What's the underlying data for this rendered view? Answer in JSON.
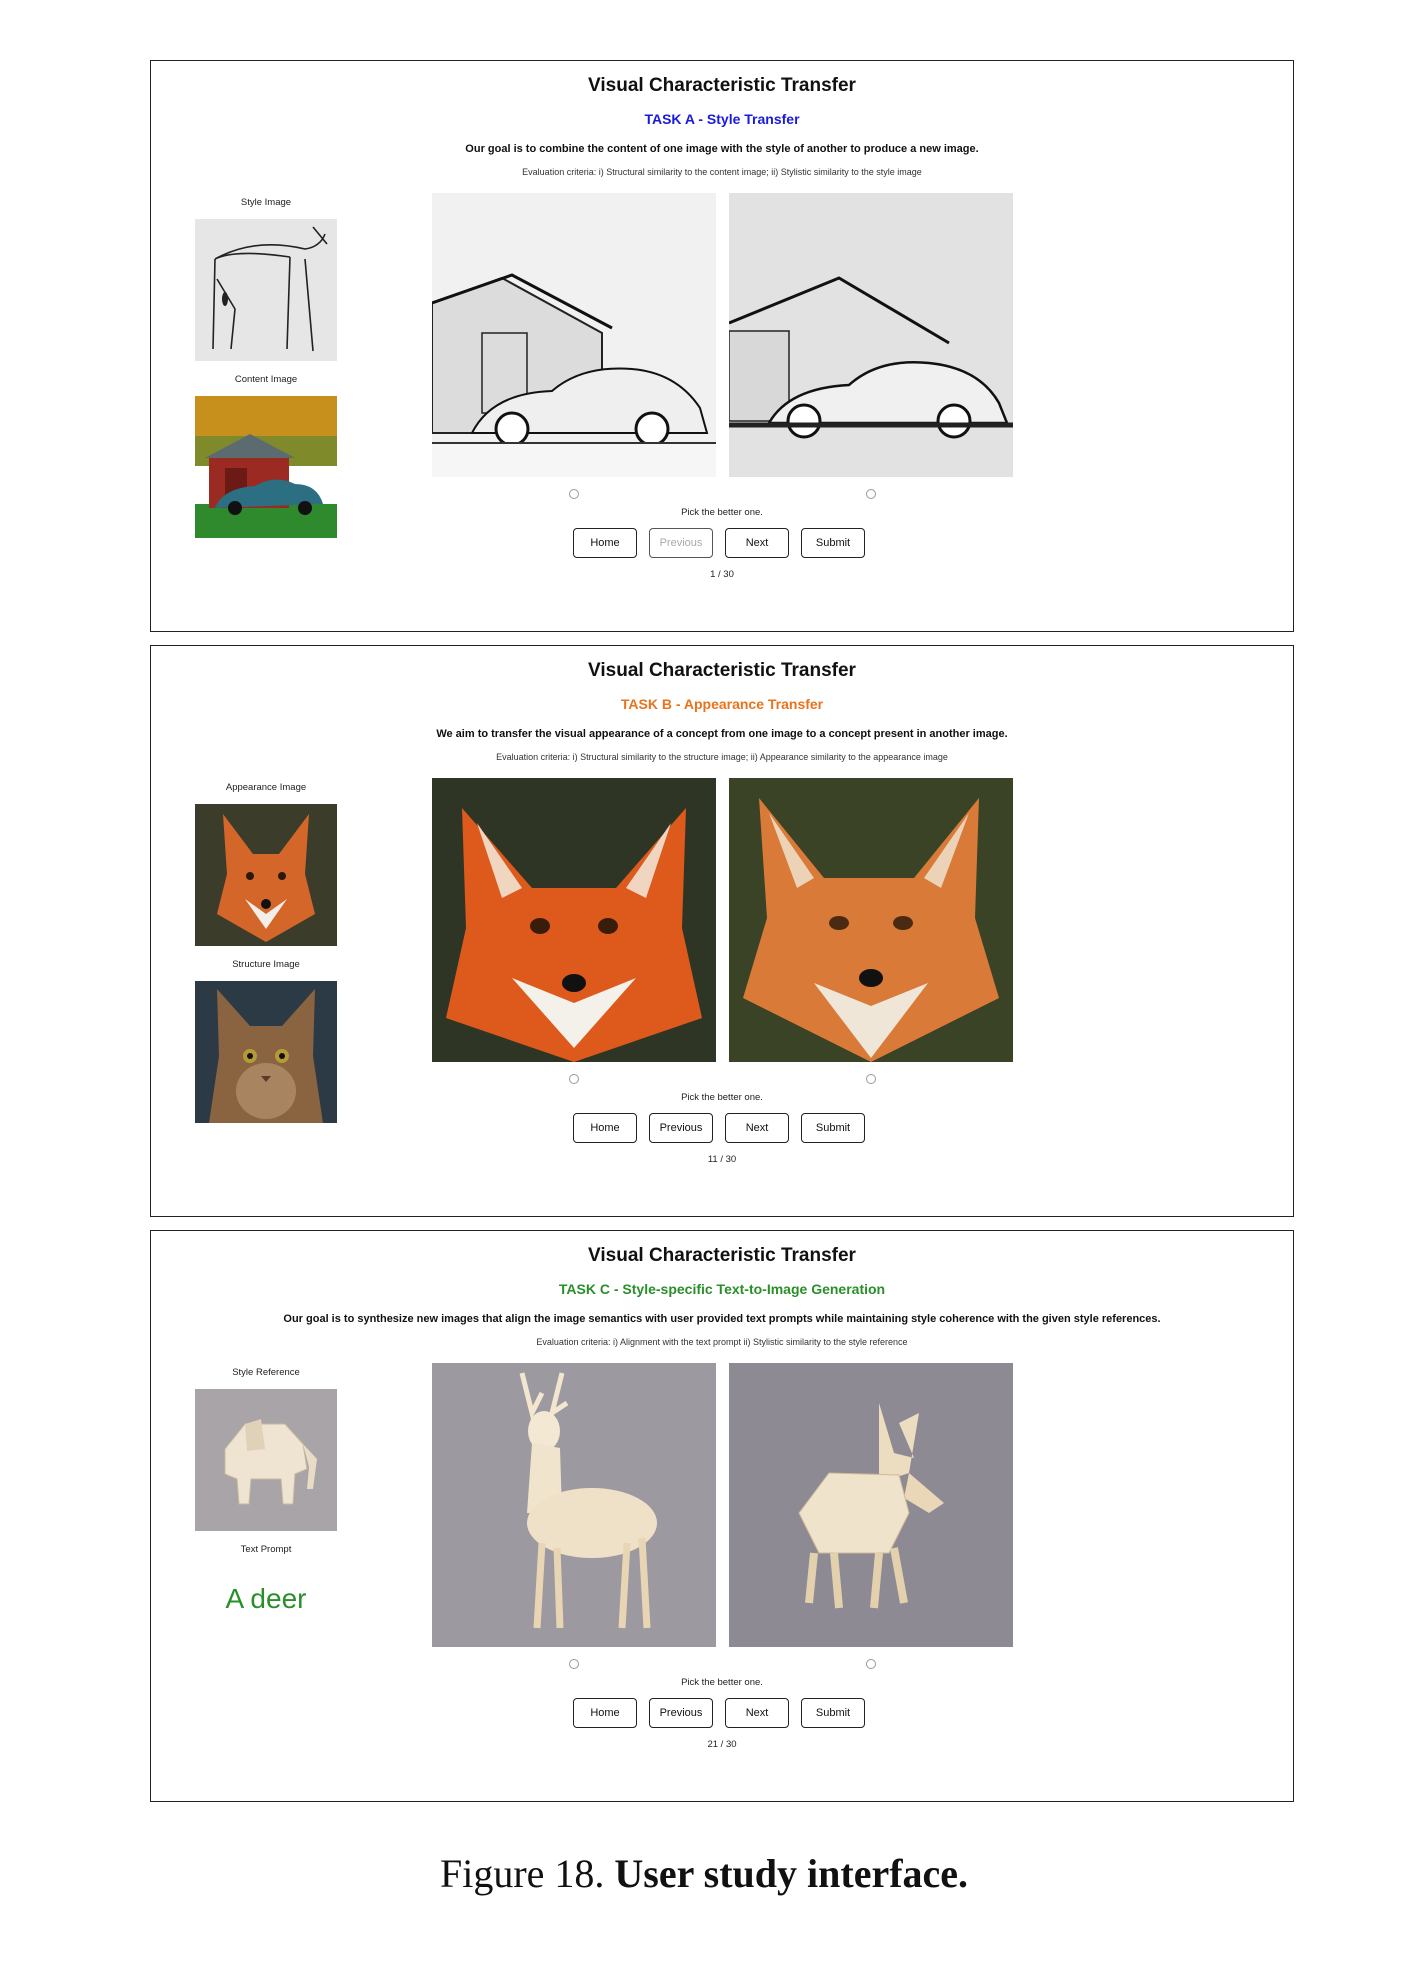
{
  "app_title": "Visual Characteristic Transfer",
  "buttons": {
    "home": "Home",
    "previous": "Previous",
    "next": "Next",
    "submit": "Submit"
  },
  "pick_text": "Pick the better one.",
  "panels": [
    {
      "task": "TASK A - Style Transfer",
      "task_color": "#1a1adc",
      "goal": "Our goal is to combine the content of one image with the style of another to produce a new image.",
      "criteria": "Evaluation criteria: i) Structural similarity to the content image; ii) Stylistic similarity to the style image",
      "side_label_1": "Style Image",
      "side_label_2": "Content Image",
      "counter": "1 / 30",
      "previous_disabled": true
    },
    {
      "task": "TASK B - Appearance Transfer",
      "task_color": "#e8731a",
      "goal": "We aim to transfer the visual appearance of a concept from one image to a concept present in another image.",
      "criteria": "Evaluation criteria: i) Structural similarity to the structure image; ii) Appearance similarity to the appearance image",
      "side_label_1": "Appearance Image",
      "side_label_2": "Structure Image",
      "counter": "11 / 30",
      "previous_disabled": false
    },
    {
      "task": "TASK C - Style-specific Text-to-Image Generation",
      "task_color": "#2a8f2a",
      "goal": "Our goal is to synthesize new images that align the image semantics with user provided text prompts while maintaining style coherence with the given style references.",
      "criteria": "Evaluation criteria: i) Alignment with the text prompt ii) Stylistic similarity to the style reference",
      "side_label_1": "Style Reference",
      "side_label_2": "Text Prompt",
      "prompt": "A deer",
      "counter": "21 / 30",
      "previous_disabled": false
    }
  ],
  "caption": {
    "prefix": "Figure 18.",
    "bold": "User study interface."
  }
}
